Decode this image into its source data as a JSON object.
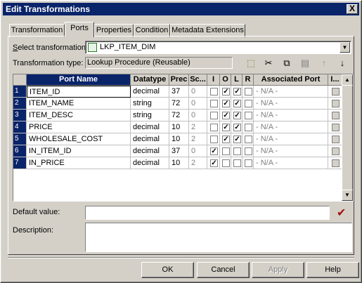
{
  "window": {
    "title": "Edit Transformations",
    "close": "X"
  },
  "tabs": [
    {
      "label": "Transformation"
    },
    {
      "label": "Ports",
      "active": true
    },
    {
      "label": "Properties"
    },
    {
      "label": "Condition"
    },
    {
      "label": "Metadata Extensions"
    }
  ],
  "select_transformation": {
    "label_u": "S",
    "label_rest": "elect transformation:",
    "value": "LKP_ITEM_DIM"
  },
  "transformation_type": {
    "label": "Transformation type:",
    "value": "Lookup Procedure (Reusable)"
  },
  "toolbar_icons": [
    "new-port-icon",
    "cut-icon",
    "copy-icon",
    "paste-icon",
    "move-up-icon",
    "move-down-icon"
  ],
  "columns": [
    "Port Name",
    "Datatype",
    "Prec",
    "Sc...",
    "I",
    "O",
    "L",
    "R",
    "Associated Port",
    "I..."
  ],
  "rows": [
    {
      "num": "1",
      "name": "ITEM_ID",
      "type": "decimal",
      "prec": "37",
      "scale": "0",
      "i": false,
      "o": true,
      "l": true,
      "r": false,
      "assoc": "- N/A -"
    },
    {
      "num": "2",
      "name": "ITEM_NAME",
      "type": "string",
      "prec": "72",
      "scale": "0",
      "i": false,
      "o": true,
      "l": true,
      "r": false,
      "assoc": "- N/A -"
    },
    {
      "num": "3",
      "name": "ITEM_DESC",
      "type": "string",
      "prec": "72",
      "scale": "0",
      "i": false,
      "o": true,
      "l": true,
      "r": false,
      "assoc": "- N/A -"
    },
    {
      "num": "4",
      "name": "PRICE",
      "type": "decimal",
      "prec": "10",
      "scale": "2",
      "i": false,
      "o": true,
      "l": true,
      "r": false,
      "assoc": "- N/A -"
    },
    {
      "num": "5",
      "name": "WHOLESALE_COST",
      "type": "decimal",
      "prec": "10",
      "scale": "2",
      "i": false,
      "o": true,
      "l": true,
      "r": false,
      "assoc": "- N/A -"
    },
    {
      "num": "6",
      "name": "IN_ITEM_ID",
      "type": "decimal",
      "prec": "37",
      "scale": "0",
      "i": true,
      "o": false,
      "l": false,
      "r": false,
      "assoc": "- N/A -"
    },
    {
      "num": "7",
      "name": "IN_PRICE",
      "type": "decimal",
      "prec": "10",
      "scale": "2",
      "i": true,
      "o": false,
      "l": false,
      "r": false,
      "assoc": "- N/A -"
    }
  ],
  "default_value": {
    "label": "Default value:",
    "value": ""
  },
  "description": {
    "label": "Description:",
    "value": ""
  },
  "buttons": {
    "ok": "OK",
    "cancel": "Cancel",
    "apply": "Apply",
    "help": "Help"
  }
}
